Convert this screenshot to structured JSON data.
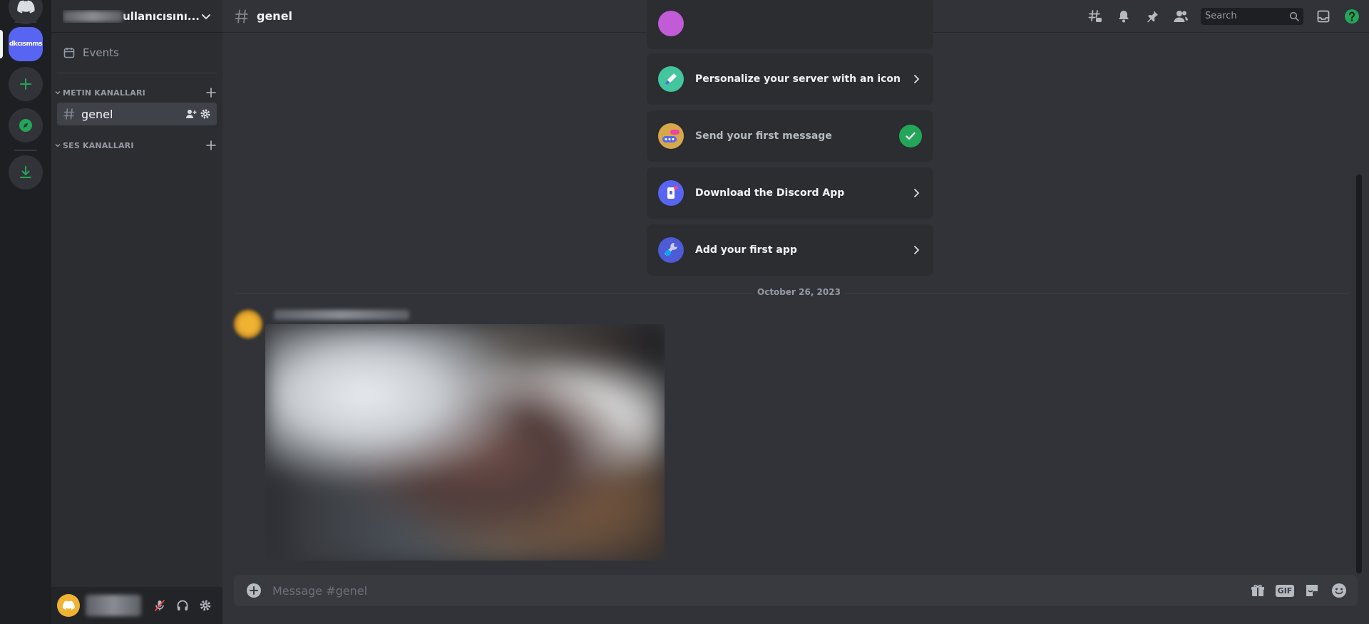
{
  "server": {
    "short_name": "dkcısmms",
    "name_visible_part": "ullanıcısını..."
  },
  "sidebar": {
    "events_label": "Events",
    "categories": [
      {
        "label": "METIN KANALLARI"
      },
      {
        "label": "SES KANALLARI"
      }
    ],
    "channels": [
      {
        "name": "genel"
      }
    ]
  },
  "header": {
    "channel_name": "genel",
    "search_placeholder": "Search"
  },
  "onboarding": {
    "items": [
      {
        "label": "Personalize your server with an icon",
        "completed": false
      },
      {
        "label": "Send your first message",
        "completed": true
      },
      {
        "label": "Download the Discord App",
        "completed": false
      },
      {
        "label": "Add your first app",
        "completed": false
      }
    ]
  },
  "messages": {
    "date_divider": "October 26, 2023"
  },
  "composer": {
    "placeholder": "Message #genel",
    "gif_label": "GIF"
  },
  "colors": {
    "brand": "#5865f2",
    "success": "#23a55a",
    "help": "#23a55a"
  }
}
